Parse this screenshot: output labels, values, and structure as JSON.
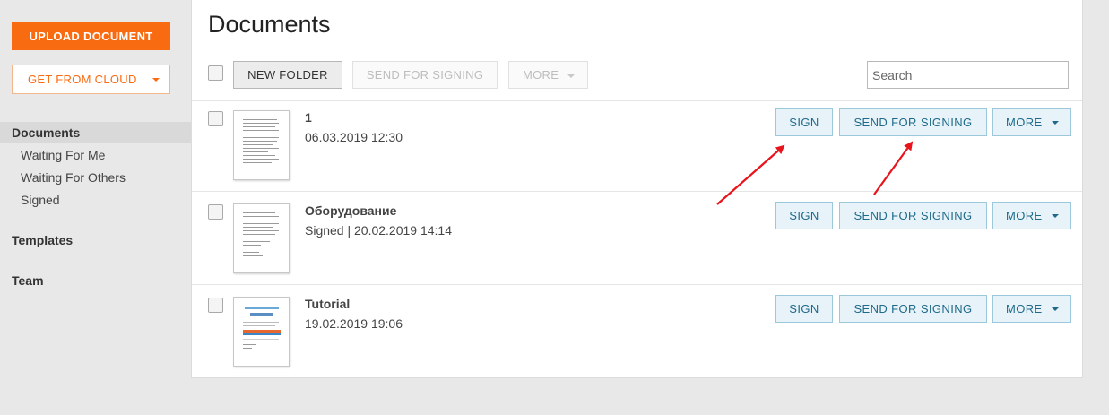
{
  "sidebar": {
    "upload_label": "UPLOAD DOCUMENT",
    "cloud_label": "GET FROM CLOUD",
    "nav": {
      "documents": "Documents",
      "waiting_for_me": "Waiting For Me",
      "waiting_for_others": "Waiting For Others",
      "signed": "Signed",
      "templates": "Templates",
      "team": "Team"
    }
  },
  "main": {
    "title": "Documents",
    "toolbar": {
      "new_folder": "NEW FOLDER",
      "send_for_signing": "SEND FOR SIGNING",
      "more": "MORE",
      "search_placeholder": "Search"
    },
    "documents": [
      {
        "name": "1",
        "meta": "06.03.2019 12:30"
      },
      {
        "name": "Оборудование",
        "meta": "Signed | 20.02.2019 14:14"
      },
      {
        "name": "Tutorial",
        "meta": "19.02.2019 19:06"
      }
    ],
    "row_actions": {
      "sign": "SIGN",
      "send_for_signing": "SEND FOR SIGNING",
      "more": "MORE"
    }
  },
  "colors": {
    "accent_orange": "#f96b11",
    "action_blue": "#1f6a8a",
    "arrow_red": "#e8131b"
  },
  "icons": [
    "chevron-down-icon",
    "document-thumbnail",
    "annotation-arrow"
  ]
}
